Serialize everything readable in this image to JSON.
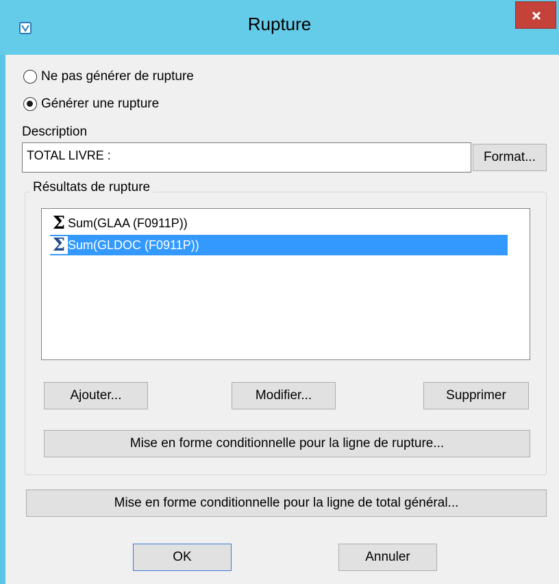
{
  "window": {
    "title": "Rupture"
  },
  "options": {
    "no_break_label": "Ne pas générer de rupture",
    "break_label": "Générer une rupture",
    "selected": "break"
  },
  "description": {
    "label": "Description",
    "value": "TOTAL LIVRE :",
    "format_button": "Format..."
  },
  "results": {
    "group_label": "Résultats de rupture",
    "items": [
      {
        "icon": "sigma-icon",
        "text": "Sum(GLAA (F0911P))",
        "selected": false
      },
      {
        "icon": "sigma-icon",
        "text": "Sum(GLDOC (F0911P))",
        "selected": true
      }
    ],
    "add_button": "Ajouter...",
    "modify_button": "Modifier...",
    "delete_button": "Supprimer",
    "conditional_break_button": "Mise en forme conditionnelle pour la ligne de rupture..."
  },
  "conditional_total_button": "Mise en forme conditionnelle pour la ligne de total général...",
  "footer": {
    "ok_button": "OK",
    "cancel_button": "Annuler"
  },
  "colors": {
    "titlebar": "#64cbe9",
    "close": "#c4423a",
    "selection": "#3399ff",
    "dialog_bg": "#f0f0f0"
  }
}
